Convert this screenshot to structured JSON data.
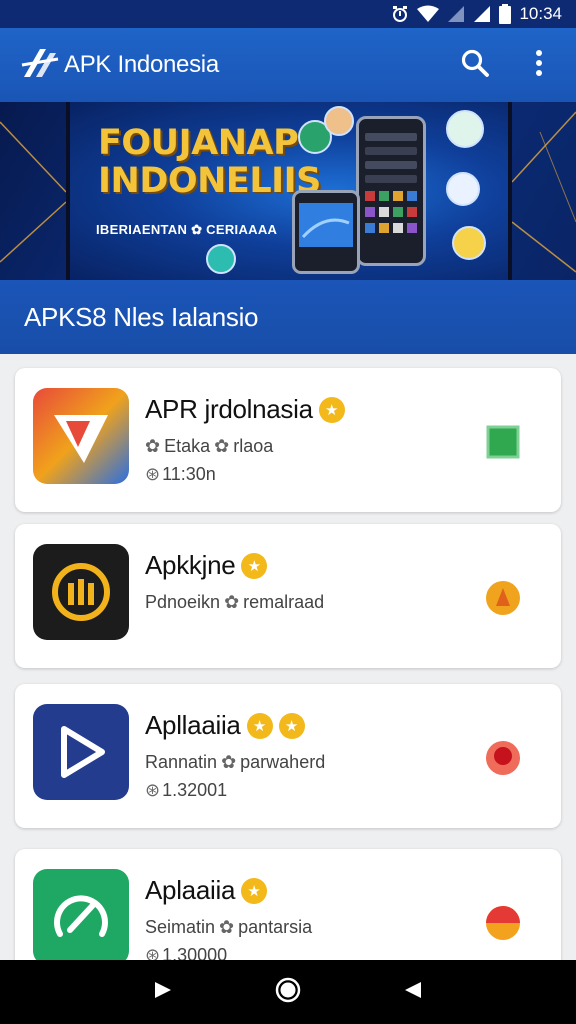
{
  "status_bar": {
    "time": "10:34"
  },
  "app_bar": {
    "title": "APK Indonesia"
  },
  "banner": {
    "headline_1": "FOUJANAP",
    "headline_2": "INDONELIIS",
    "tagline": "IBERIAENTAN ✿ CERIAAAA"
  },
  "section": {
    "title": "APKS8 Nles Ialansio"
  },
  "apps": [
    {
      "name": "APR jrdolnasia",
      "stars": 1,
      "line2_a": "Etaka",
      "line2_b": "rlaoa",
      "line3": "11:30n",
      "accent": "#e8423a",
      "status_color": "#2fa84f"
    },
    {
      "name": "Apkkjne",
      "stars": 1,
      "line2_a": "Pdnoeikn",
      "line2_b": "remalraad",
      "line3": "",
      "accent": "#1c1c1c",
      "status_color": "#f0a31c"
    },
    {
      "name": "Apllaaiia",
      "stars": 2,
      "line2_a": "Rannatin",
      "line2_b": "parwaherd",
      "line3": "1.32001",
      "accent": "#233c8e",
      "status_color": "#e53935"
    },
    {
      "name": "Aplaaiia",
      "stars": 1,
      "line2_a": "Seimatin",
      "line2_b": "pantarsia",
      "line3": "1.30000",
      "accent": "#1ea864",
      "status_color": "#f2a21c"
    }
  ],
  "icons": {
    "status": [
      "alarm-icon",
      "wifi-icon",
      "signal-icon",
      "signal-icon",
      "battery-icon"
    ],
    "app_bar": [
      "search-icon",
      "more-vert-icon"
    ],
    "nav": [
      "back-icon",
      "home-icon",
      "recents-icon"
    ]
  }
}
